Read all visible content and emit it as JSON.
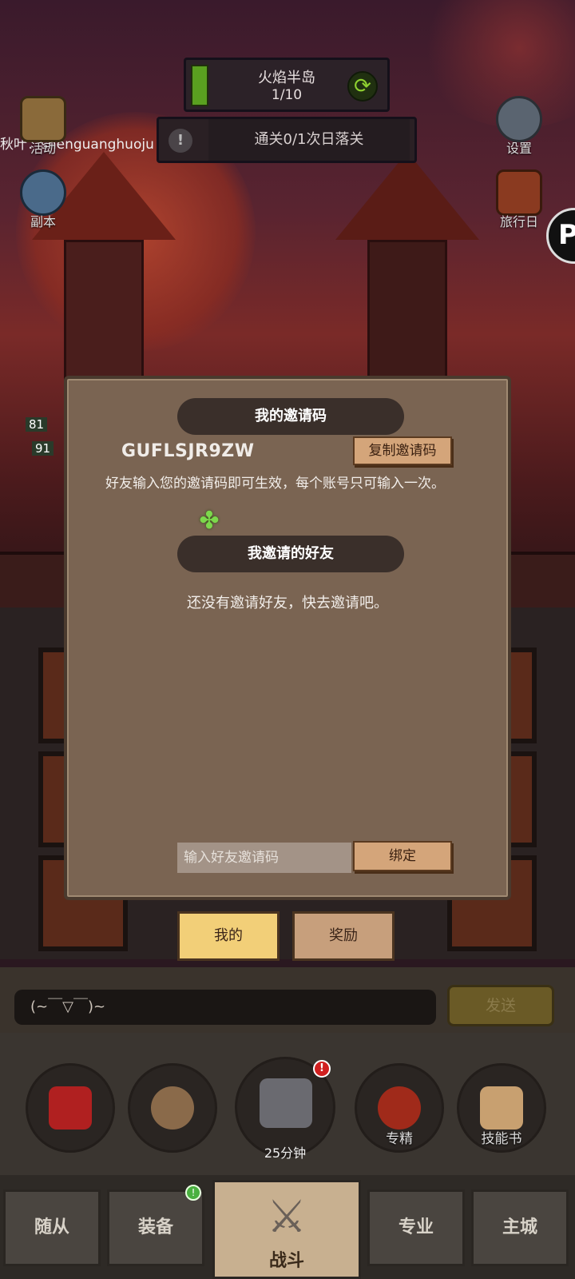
{
  "hud": {
    "stage_name": "火焰半岛",
    "stage_progress": "1/10",
    "status_text": "通关0/1次日落关",
    "marquee": "秋叶：shenguanghuoju"
  },
  "side": {
    "activity_label": "活动",
    "dungeon_label": "副本",
    "settings_label": "设置",
    "journal_label": "旅行日"
  },
  "levels": [
    "81",
    "91"
  ],
  "modal": {
    "my_code_title": "我的邀请码",
    "invite_code": "GUFLSJR9ZW",
    "copy_button": "复制邀请码",
    "description": "好友输入您的邀请码即可生效，每个账号只可输入一次。",
    "friends_title": "我邀请的好友",
    "empty_text": "还没有邀请好友，快去邀请吧。",
    "input_placeholder": "输入好友邀请码",
    "bind_button": "绑定"
  },
  "tabs": [
    {
      "label": "我的",
      "active": true
    },
    {
      "label": "奖励",
      "active": false
    }
  ],
  "chat": {
    "input_text": "(~￣▽￣)~",
    "send_button": "发送"
  },
  "actions": {
    "chest_timer": "25分钟",
    "chest_alert": "!",
    "mastery_label": "专精",
    "skillbook_label": "技能书"
  },
  "nav": {
    "followers": "随从",
    "equipment": "装备",
    "battle": "战斗",
    "profession": "专业",
    "main_city": "主城",
    "equipment_badge": "!"
  },
  "colors": {
    "modal_bg": "#7a6452",
    "pill_bg": "#3a2f2a",
    "wood_button": "#d4a57a",
    "active_tab": "#f2cf78",
    "inactive_tab": "#c79f7c"
  }
}
